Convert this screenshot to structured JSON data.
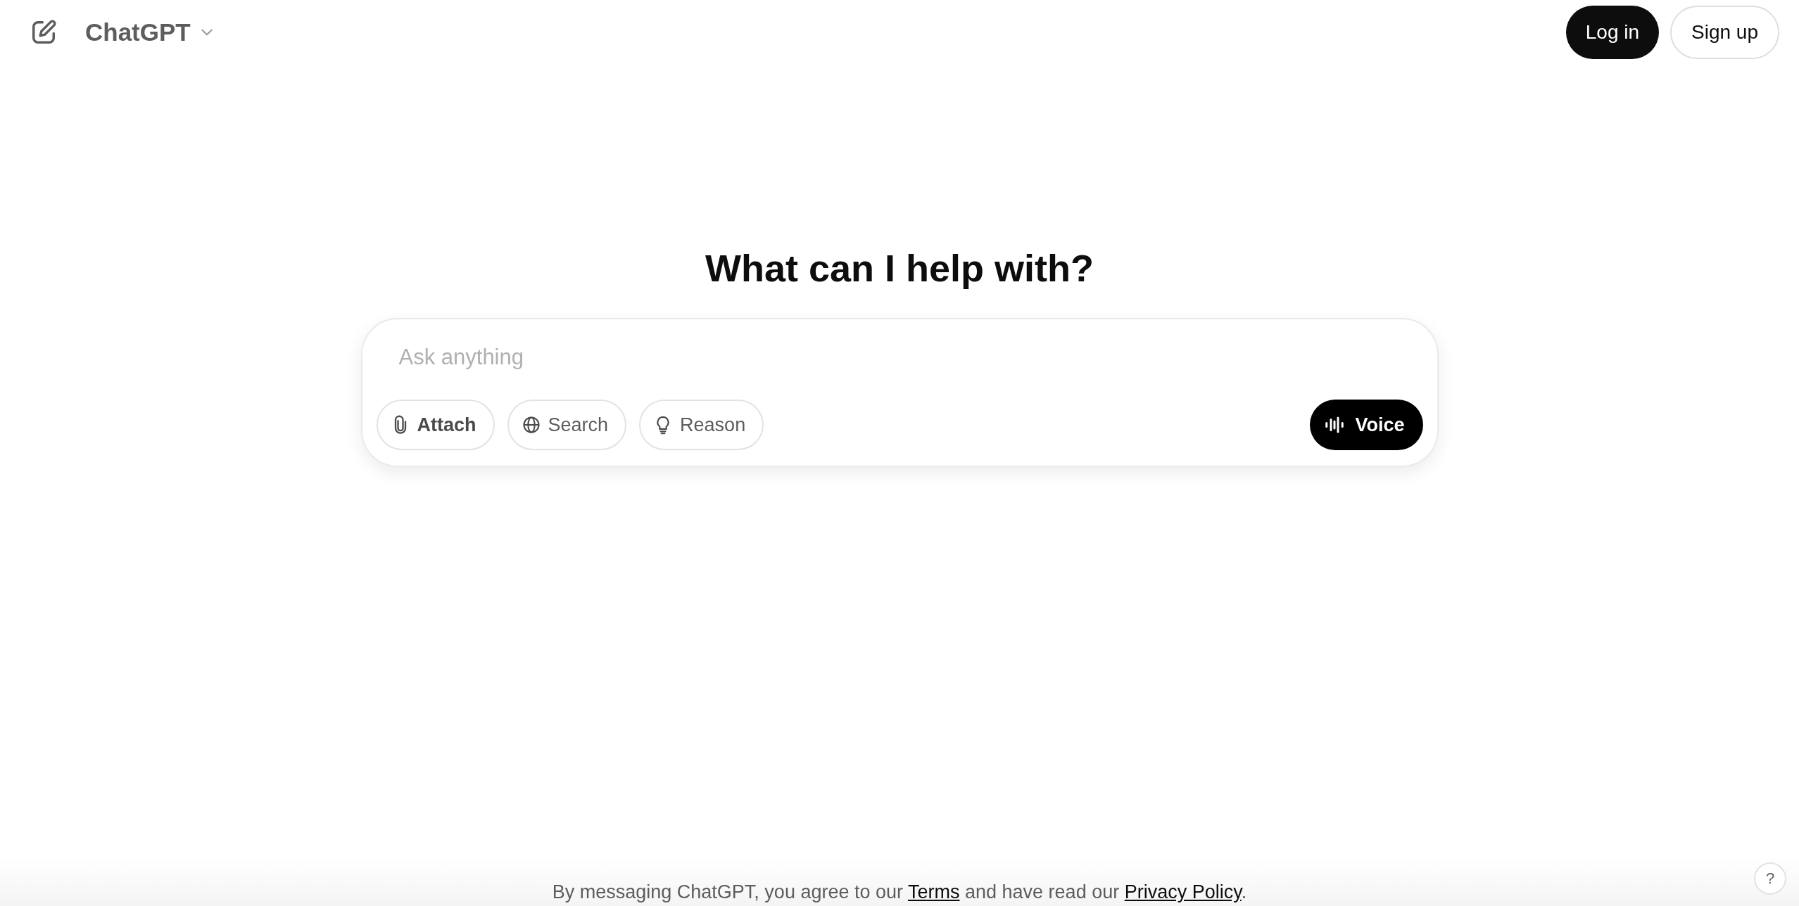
{
  "header": {
    "app_name": "ChatGPT",
    "buttons": [
      {
        "label": "Log in",
        "kind": "primary"
      },
      {
        "label": "Sign up",
        "kind": "secondary"
      }
    ]
  },
  "heading": "What can I help with?",
  "composer": {
    "placeholder": "Ask anything",
    "tools": [
      {
        "label": "Attach",
        "kind": "attach"
      },
      {
        "label": "Search",
        "kind": "search"
      },
      {
        "label": "Reason",
        "kind": "reason"
      }
    ],
    "voice_button": "Voice"
  },
  "footer": {
    "prefix": "By messaging ChatGPT, you agree to our ",
    "terms_link": "Terms",
    "middle": " and have read our ",
    "privacy_link": "Privacy Policy",
    "suffix": ".",
    "help_button": "?"
  }
}
